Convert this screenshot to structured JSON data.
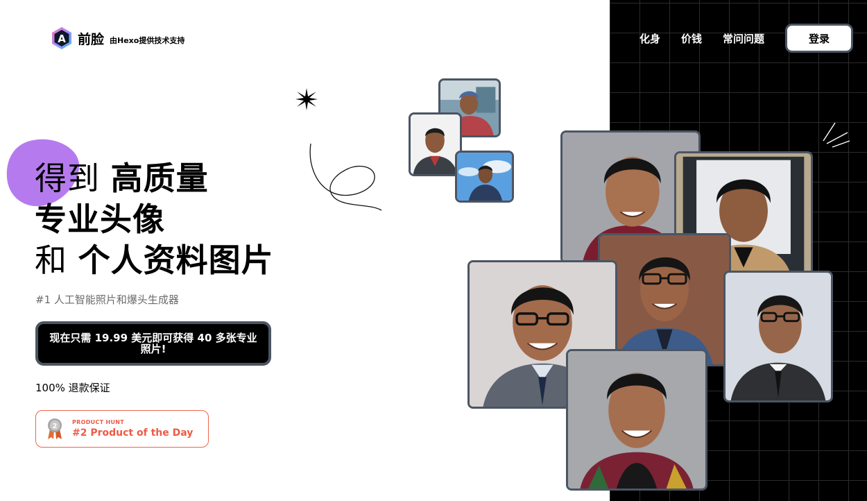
{
  "header": {
    "brand": "前脸",
    "powered_by": "由Hexo提供技术支持",
    "nav": [
      "化身",
      "价钱",
      "常问问题"
    ],
    "login_label": "登录"
  },
  "hero": {
    "line1_light": "得到",
    "line1_strong": "高质量",
    "line2_strong": "专业头像",
    "line3_light": "和",
    "line3_strong": "个人资料图片",
    "subtitle": "#1 人工智能照片和爆头生成器",
    "cta_label": "现在只需 19.99 美元即可获得 40 多张专业照片!",
    "guarantee": "100% 退款保证"
  },
  "badge": {
    "kicker": "PRODUCT HUNT",
    "title": "#2 Product of the Day",
    "medal_number": "2"
  },
  "colors": {
    "accent_purple": "#b57bee",
    "badge_red": "#ee5a45",
    "frame_gray": "#4b5563"
  },
  "icons": [
    "logo-mark-icon",
    "sparkle-star-icon",
    "squiggle-decoration",
    "spark-lines-icon",
    "medal-icon"
  ]
}
